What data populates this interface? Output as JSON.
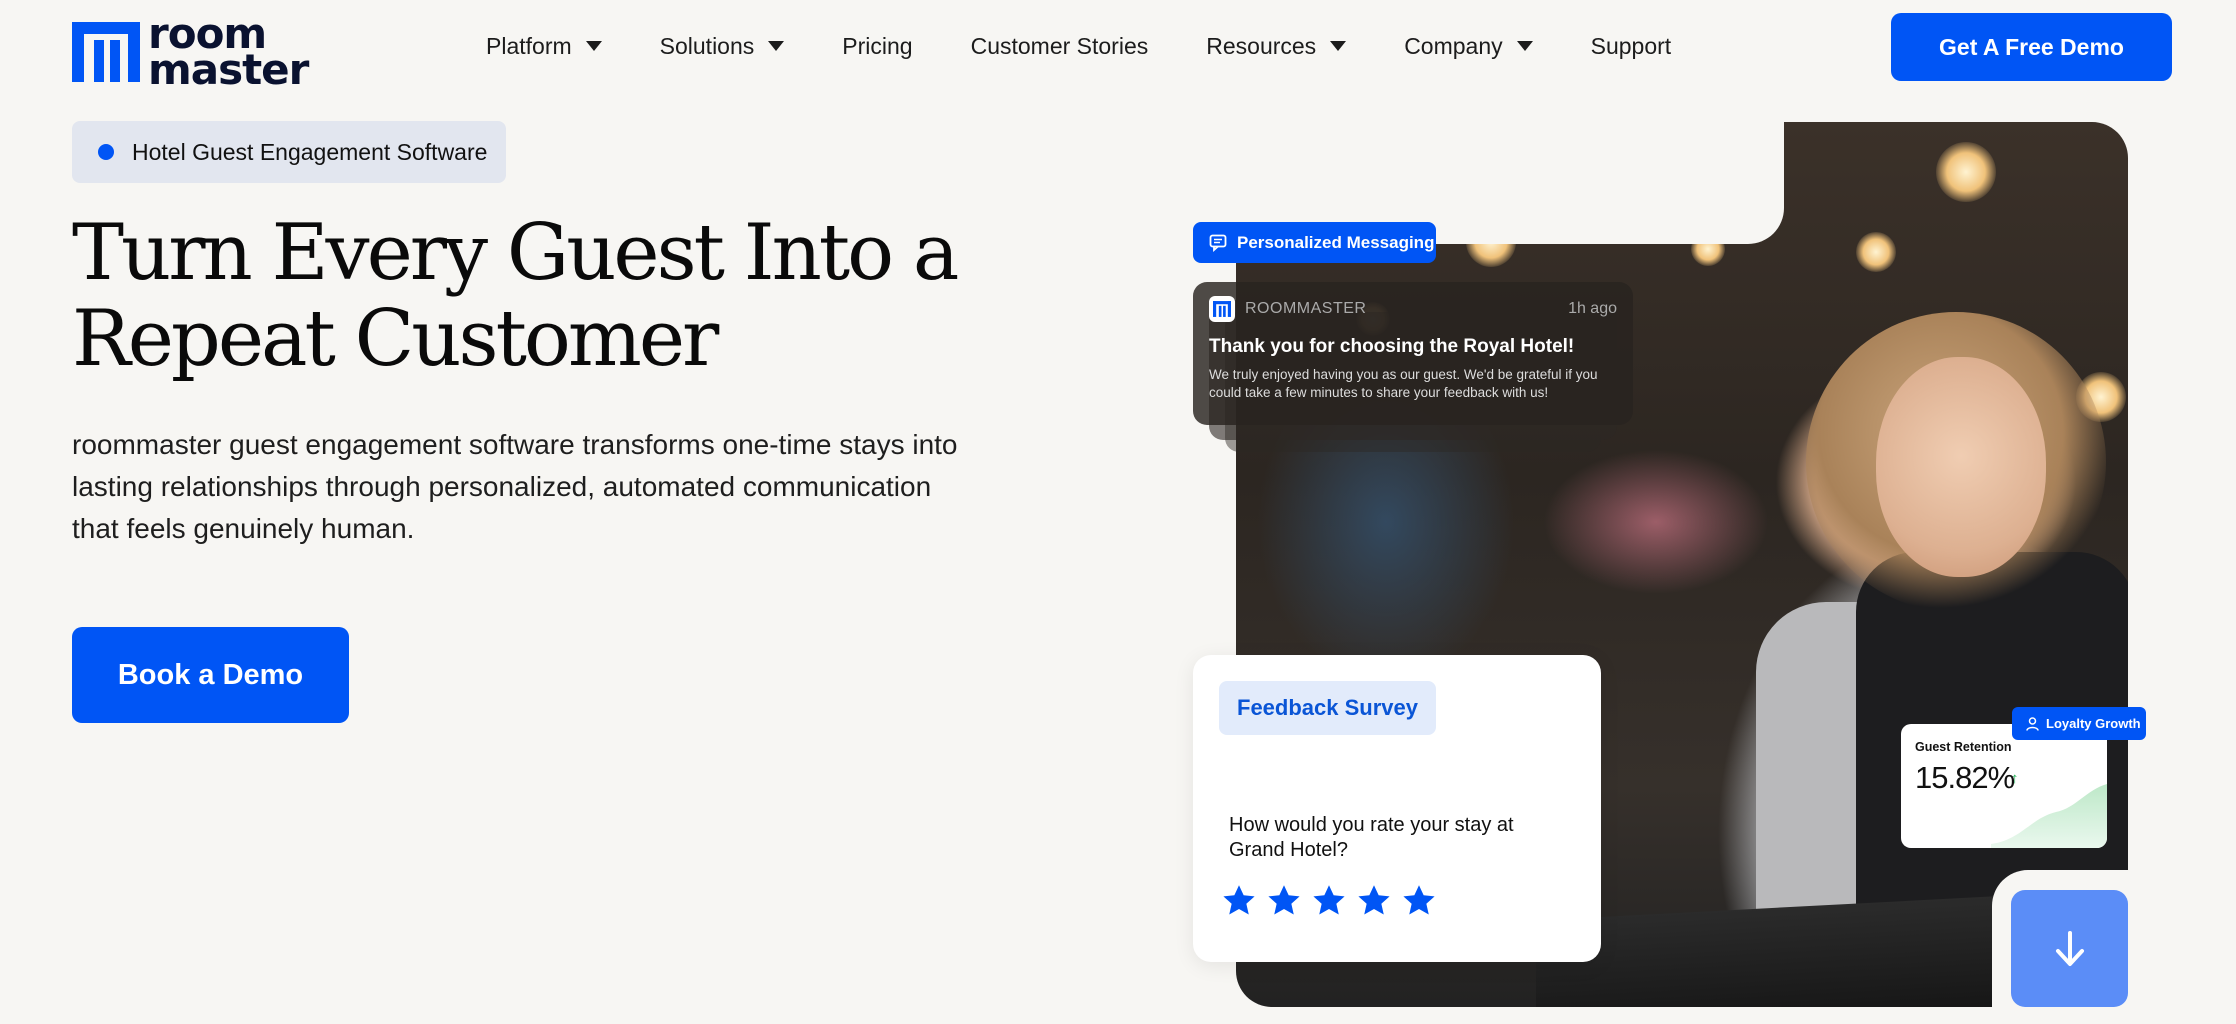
{
  "brand": {
    "logo_line1": "room",
    "logo_line2": "master"
  },
  "nav": {
    "items": [
      {
        "label": "Platform",
        "has_dropdown": true
      },
      {
        "label": "Solutions",
        "has_dropdown": true
      },
      {
        "label": "Pricing",
        "has_dropdown": false
      },
      {
        "label": "Customer Stories",
        "has_dropdown": false
      },
      {
        "label": "Resources",
        "has_dropdown": true
      },
      {
        "label": "Company",
        "has_dropdown": true
      },
      {
        "label": "Support",
        "has_dropdown": false
      }
    ],
    "cta_label": "Get A Free Demo"
  },
  "hero": {
    "pill_label": "Hotel Guest Engagement Software",
    "headline_line1": "Turn Every Guest Into a",
    "headline_line2": "Repeat Customer",
    "subheadline": "roommaster guest engagement software transforms one-time stays into lasting relationships through personalized, automated communication that feels genuinely human.",
    "cta_label": "Book a Demo"
  },
  "messaging": {
    "tag_label": "Personalized Messaging",
    "notification": {
      "app_name": "ROOMMASTER",
      "time": "1h ago",
      "title": "Thank you for choosing the Royal Hotel!",
      "body": "We truly enjoyed having you as our guest. We'd be grateful if you could take a few minutes to share your feedback with us!"
    }
  },
  "survey": {
    "tag_label": "Feedback Survey",
    "question": "How would you rate your stay at Grand Hotel?",
    "rating": 5,
    "max_rating": 5
  },
  "retention": {
    "tag_label": "Loyalty Growth",
    "label": "Guest Retention",
    "value": "15.82%",
    "trend_icon": "arrow-up-icon"
  },
  "colors": {
    "accent": "#0055f5",
    "background": "#f7f6f3",
    "pill_bg": "#e2e6ef",
    "trend_green": "#27b35c",
    "scroll_btn": "#5b8df7"
  },
  "icons": {
    "scroll": "arrow-down-icon",
    "message": "chat-bubble-icon",
    "user": "user-icon",
    "star": "star-icon"
  }
}
